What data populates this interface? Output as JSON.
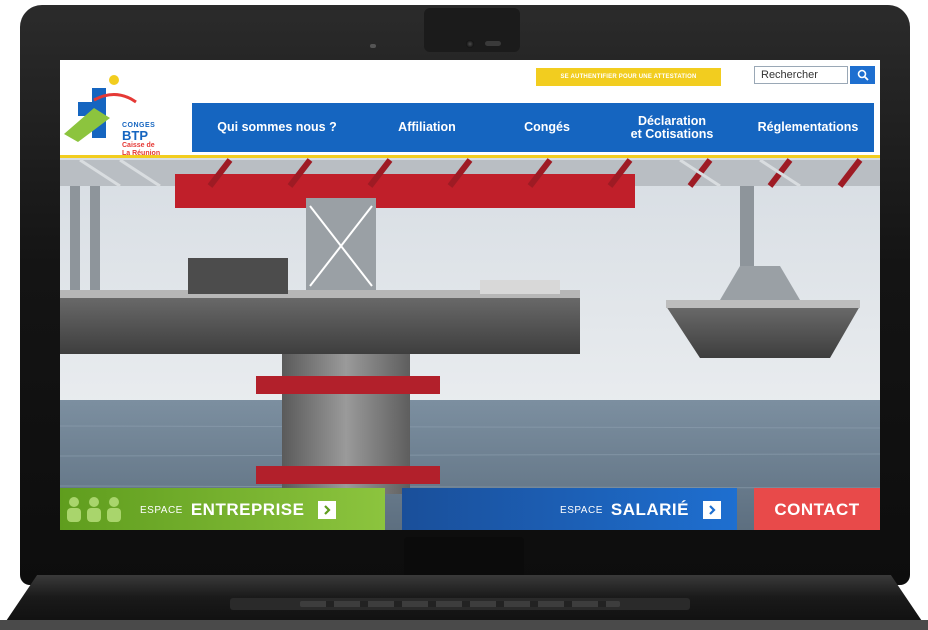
{
  "header": {
    "logo": {
      "line1": "CONGES",
      "line2": "BTP",
      "line3": "Caisse de",
      "line4": "La Réunion"
    },
    "top_link": "SE AUTHENTIFIER POUR UNE ATTESTATION",
    "search": {
      "placeholder": "Rechercher",
      "icon": "search-icon"
    }
  },
  "nav": {
    "items": [
      {
        "label": "Qui sommes nous ?"
      },
      {
        "label": "Affiliation"
      },
      {
        "label": "Congés"
      },
      {
        "label": "Déclaration\net Cotisations"
      },
      {
        "label": "Réglementations"
      }
    ]
  },
  "hero": {
    "image": "bridge-construction-over-sea"
  },
  "cta": {
    "entreprise": {
      "small": "ESPACE",
      "big": "ENTREPRISE",
      "icon": "people-icon"
    },
    "salarie": {
      "small": "ESPACE",
      "big": "SALARIÉ",
      "icon": "chevron-right-icon"
    },
    "contact": {
      "label": "CONTACT"
    }
  },
  "colors": {
    "brand_blue": "#1565c0",
    "accent_yellow": "#f2cd1f",
    "green": "#8cc43e",
    "red": "#e84a4a"
  }
}
